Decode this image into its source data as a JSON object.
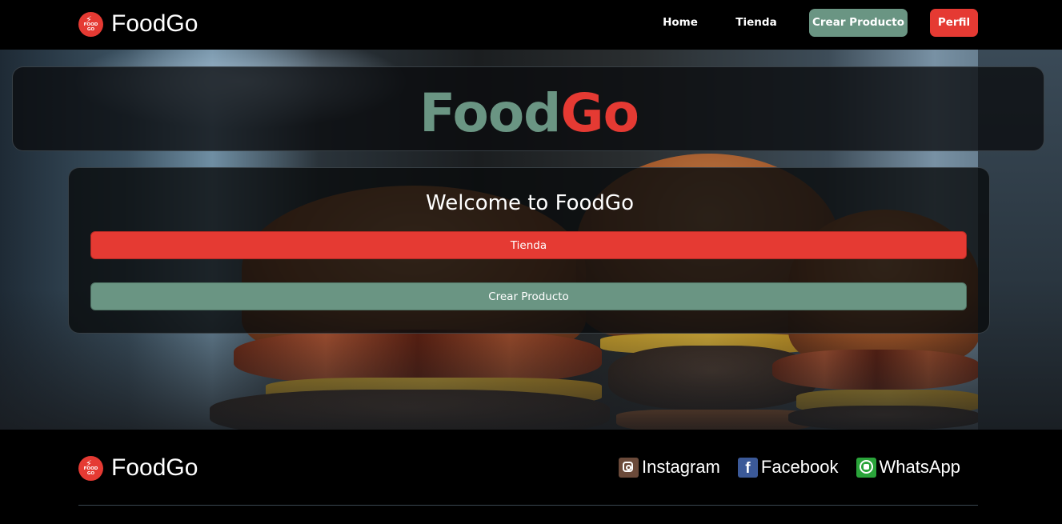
{
  "brand": {
    "name": "FoodGo",
    "logo_top": "FOOD",
    "logo_bottom": "GO"
  },
  "nav": {
    "home": "Home",
    "tienda": "Tienda",
    "crear": "Crear Producto",
    "perfil": "Perfil"
  },
  "hero": {
    "title_part1": "Food",
    "title_part2": "Go",
    "welcome": "Welcome to FoodGo",
    "btn_tienda": "Tienda",
    "btn_crear": "Crear Producto"
  },
  "footer": {
    "brand": "FoodGo",
    "socials": [
      {
        "label": "Instagram",
        "icon": "instagram-icon"
      },
      {
        "label": "Facebook",
        "icon": "facebook-icon"
      },
      {
        "label": "WhatsApp",
        "icon": "whatsapp-icon"
      }
    ]
  },
  "colors": {
    "green": "#6a9583",
    "red": "#e53a33",
    "bg": "#000000"
  }
}
